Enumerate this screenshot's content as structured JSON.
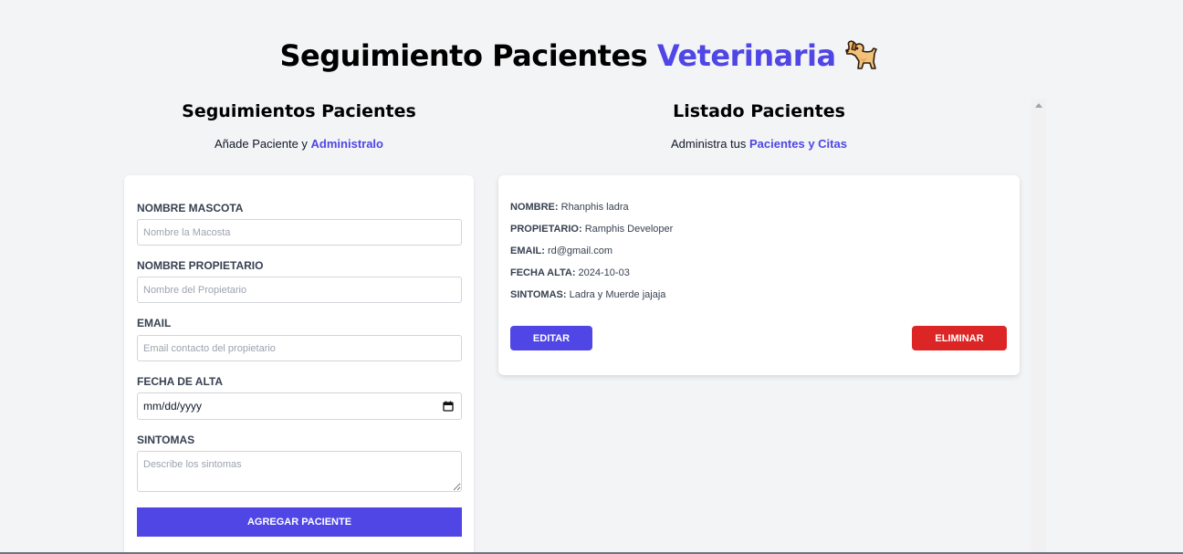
{
  "header": {
    "title_part1": "Seguimiento Pacientes",
    "title_accent": "Veterinaria",
    "icon": "dog-icon",
    "accent_color": "#4f46e5"
  },
  "form_section": {
    "heading": "Seguimientos Pacientes",
    "subtitle_prefix": "Añade Paciente y",
    "subtitle_highlight": "Administralo",
    "fields": {
      "pet_name": {
        "label": "NOMBRE MASCOTA",
        "placeholder": "Nombre la Macosta"
      },
      "owner_name": {
        "label": "NOMBRE PROPIETARIO",
        "placeholder": "Nombre del Propietario"
      },
      "email": {
        "label": "EMAIL",
        "placeholder": "Email contacto del propietario"
      },
      "discharge_date": {
        "label": "FECHA DE ALTA",
        "placeholder": "mm/dd/yyyy"
      },
      "symptoms": {
        "label": "SINTOMAS",
        "placeholder": "Describe los sintomas"
      }
    },
    "submit_label": "AGREGAR PACIENTE"
  },
  "list_section": {
    "heading": "Listado Pacientes",
    "subtitle_prefix": "Administra tus",
    "subtitle_highlight": "Pacientes y Citas",
    "patient": {
      "name_key": "NOMBRE:",
      "name_value": "Rhanphis ladra",
      "owner_key": "PROPIETARIO:",
      "owner_value": "Ramphis Developer",
      "email_key": "EMAIL:",
      "email_value": "rd@gmail.com",
      "date_key": "FECHA ALTA:",
      "date_value": "2024-10-03",
      "symptoms_key": "SINTOMAS:",
      "symptoms_value": "Ladra y Muerde jajaja"
    },
    "edit_label": "EDITAR",
    "delete_label": "ELIMINAR",
    "edit_color": "#4f46e5",
    "delete_color": "#dc2626"
  }
}
